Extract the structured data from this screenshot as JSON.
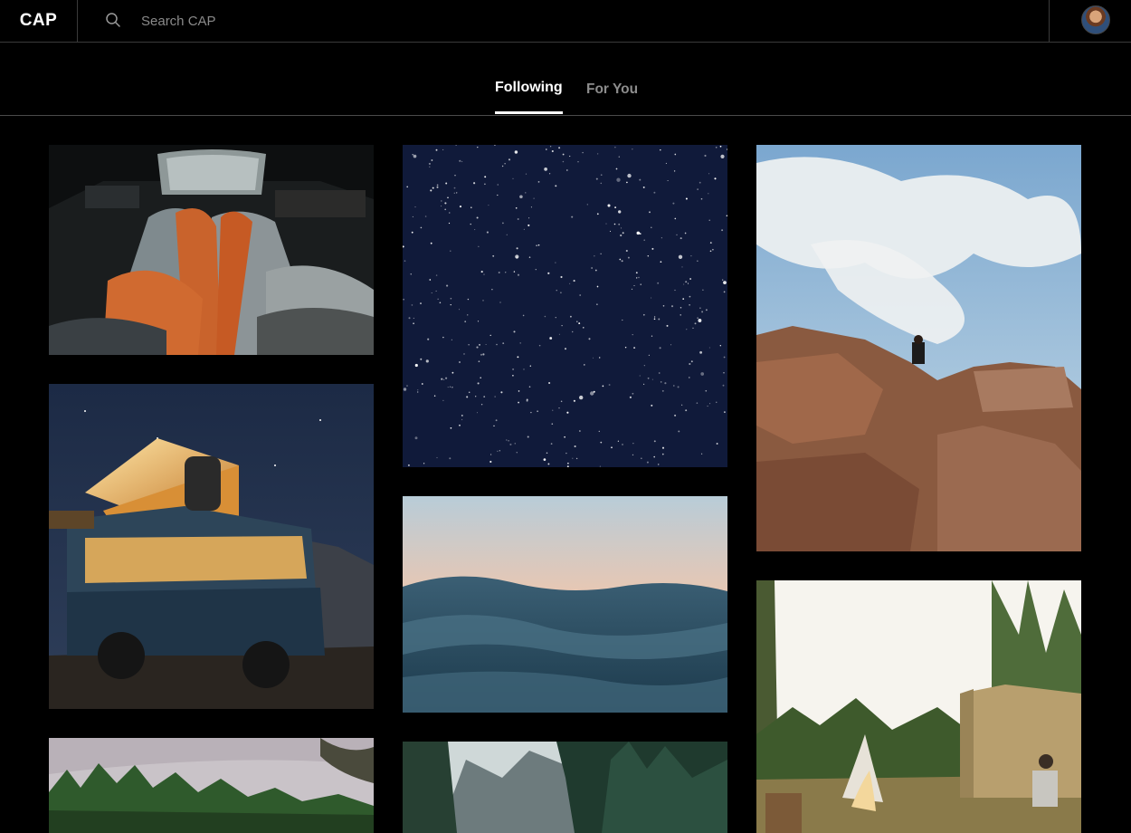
{
  "app": {
    "logo": "CAP"
  },
  "search": {
    "placeholder": "Search CAP",
    "value": ""
  },
  "tabs": [
    {
      "label": "Following",
      "active": true
    },
    {
      "label": "For You",
      "active": false
    }
  ],
  "colors": {
    "background": "#000000",
    "divider": "#3a3a3a",
    "active_tab": "#ffffff",
    "inactive_tab": "#8c8c8c"
  },
  "icons": {
    "search": "search-icon",
    "account": "avatar"
  },
  "photos": [
    {
      "subject": "sleeping-bags-in-car",
      "column": 1
    },
    {
      "subject": "starry-night-sky",
      "column": 2
    },
    {
      "subject": "hiker-on-rocks",
      "column": 3
    },
    {
      "subject": "lit-camper-van-at-night",
      "column": 1
    },
    {
      "subject": "ocean-waves-at-dusk",
      "column": 2
    },
    {
      "subject": "campfire-and-tent",
      "column": 3
    },
    {
      "subject": "pine-forest-cloudy",
      "column": 1
    },
    {
      "subject": "canyon-with-trees",
      "column": 2
    }
  ]
}
